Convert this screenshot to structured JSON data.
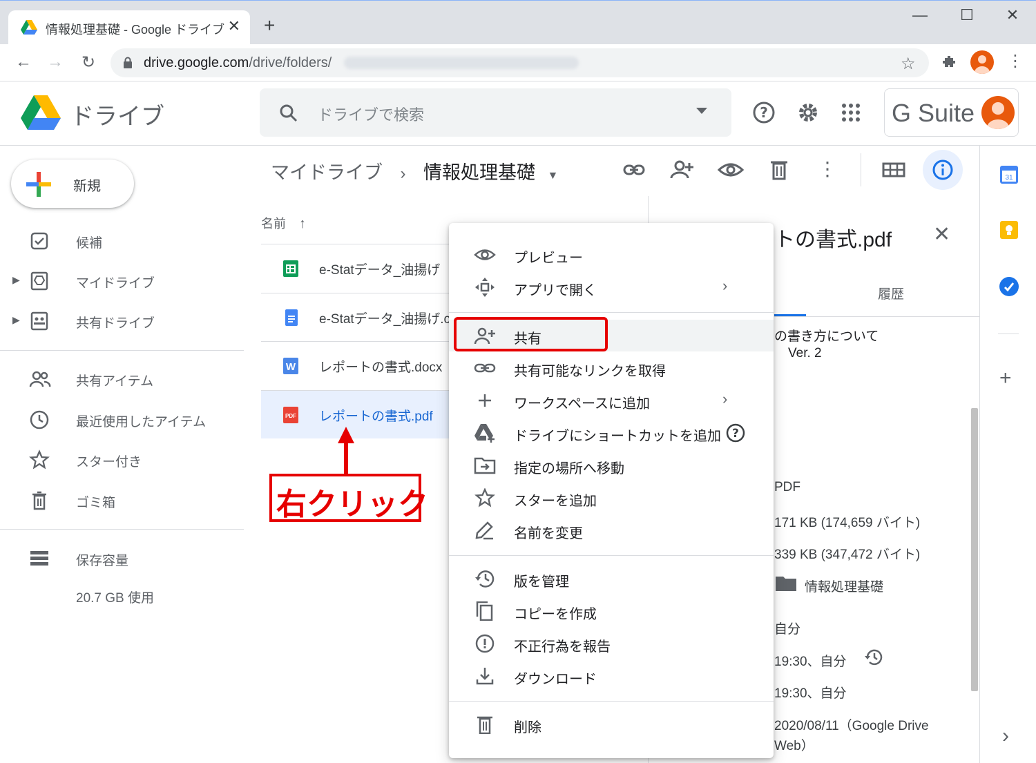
{
  "browser": {
    "tab_title": "情報処理基礎 - Google ドライブ",
    "tab_close": "✕",
    "new_tab": "+",
    "url_host": "drive.google.com",
    "url_path": "/drive/folders/",
    "window_controls": [
      "—",
      "☐",
      "✕"
    ]
  },
  "header": {
    "brand": "ドライブ",
    "search_placeholder": "ドライブで検索",
    "gsuite": "G Suite"
  },
  "sidebar": {
    "new_label": "新規",
    "items": [
      {
        "label": "候補",
        "icon": "suggestions-icon"
      },
      {
        "label": "マイドライブ",
        "icon": "my-drive-icon"
      },
      {
        "label": "共有ドライブ",
        "icon": "shared-drives-icon"
      },
      {
        "label": "共有アイテム",
        "icon": "shared-with-me-icon"
      },
      {
        "label": "最近使用したアイテム",
        "icon": "recent-icon"
      },
      {
        "label": "スター付き",
        "icon": "star-icon"
      },
      {
        "label": "ゴミ箱",
        "icon": "trash-icon"
      },
      {
        "label": "保存容量",
        "icon": "storage-icon"
      }
    ],
    "storage_used": "20.7 GB 使用"
  },
  "breadcrumb": {
    "root": "マイドライブ",
    "separator": "›",
    "current": "情報処理基礎"
  },
  "list": {
    "column_name": "名前",
    "sort_arrow": "↑",
    "files": [
      {
        "name": "e-Statデータ_油揚げ",
        "type": "sheets",
        "color": "#0f9d58"
      },
      {
        "name": "e-Statデータ_油揚げ.c",
        "type": "docs",
        "color": "#4285f4"
      },
      {
        "name": "レポートの書式.docx",
        "type": "word",
        "color": "#4a86e8"
      },
      {
        "name": "レポートの書式.pdf",
        "type": "pdf",
        "color": "#ea4335"
      }
    ]
  },
  "details": {
    "title": "トの書式.pdf",
    "tab_history": "履歴",
    "preview_line1": "の書き方について",
    "preview_line2": "Ver. 2",
    "type": "PDF",
    "size": "171 KB (174,659 バイト)",
    "storage": "339 KB (347,472 バイト)",
    "location": "情報処理基礎",
    "owner": "自分",
    "modified": "19:30、自分",
    "opened": "19:30、自分",
    "created_line1": "2020/08/11（Google Drive",
    "created_line2": "Web）"
  },
  "context_menu": {
    "items": [
      {
        "label": "プレビュー",
        "icon": "eye-icon"
      },
      {
        "label": "アプリで開く",
        "icon": "open-with-icon",
        "submenu": true
      },
      {
        "label": "共有",
        "icon": "person-add-icon",
        "highlight": true
      },
      {
        "label": "共有可能なリンクを取得",
        "icon": "link-icon"
      },
      {
        "label": "ワークスペースに追加",
        "icon": "plus-icon",
        "submenu": true
      },
      {
        "label": "ドライブにショートカットを追加",
        "icon": "drive-add-icon"
      },
      {
        "label": "指定の場所へ移動",
        "icon": "move-icon"
      },
      {
        "label": "スターを追加",
        "icon": "star-icon"
      },
      {
        "label": "名前を変更",
        "icon": "pencil-icon"
      },
      {
        "label": "版を管理",
        "icon": "history-icon"
      },
      {
        "label": "コピーを作成",
        "icon": "copy-icon"
      },
      {
        "label": "不正行為を報告",
        "icon": "report-icon"
      },
      {
        "label": "ダウンロード",
        "icon": "download-icon"
      },
      {
        "label": "削除",
        "icon": "trash-icon"
      }
    ],
    "chevron": "›"
  },
  "annotation": {
    "callout": "右クリック",
    "color": "#e60000"
  },
  "colors": {
    "accent": "#1a73e8",
    "selected_bg": "#e8f0fe",
    "annotation": "#e60000"
  }
}
